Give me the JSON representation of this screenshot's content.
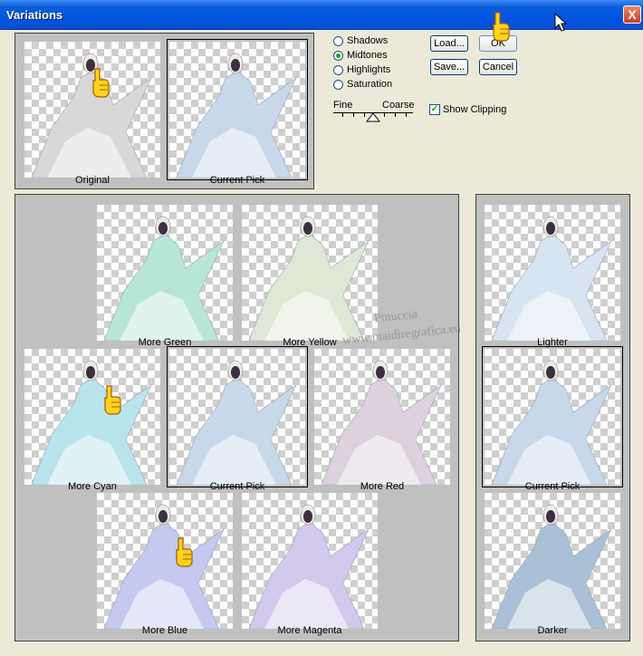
{
  "window": {
    "title": "Variations",
    "close_label": "X"
  },
  "top": {
    "original_label": "Original",
    "current_pick_label": "Current Pick"
  },
  "options": {
    "radios": [
      {
        "label": "Shadows",
        "checked": false
      },
      {
        "label": "Midtones",
        "checked": true
      },
      {
        "label": "Highlights",
        "checked": false
      },
      {
        "label": "Saturation",
        "checked": false
      }
    ],
    "fine_label": "Fine",
    "coarse_label": "Coarse",
    "show_clipping_label": "Show Clipping",
    "show_clipping_checked": true
  },
  "buttons": {
    "load": "Load...",
    "ok": "OK",
    "save": "Save...",
    "cancel": "Cancel"
  },
  "grid": {
    "more_green": "More Green",
    "more_yellow": "More Yellow",
    "more_cyan": "More Cyan",
    "current_pick": "Current Pick",
    "more_red": "More Red",
    "more_blue": "More Blue",
    "more_magenta": "More Magenta"
  },
  "brightness": {
    "lighter": "Lighter",
    "current_pick": "Current Pick",
    "darker": "Darker"
  },
  "watermark": {
    "line1": "Pinuccia",
    "line2": "www.maidiregrafica.eu"
  },
  "tints": {
    "original": "#d8d8d8",
    "current": "#c7d8ea",
    "more_green": "#b7e6d8",
    "more_yellow": "#dfe8d5",
    "more_cyan": "#b9e4ee",
    "more_red": "#dcd1dd",
    "more_blue": "#c3c9ef",
    "more_magenta": "#d2c9ec",
    "lighter": "#d7e4f1",
    "darker": "#a9c0d6"
  }
}
